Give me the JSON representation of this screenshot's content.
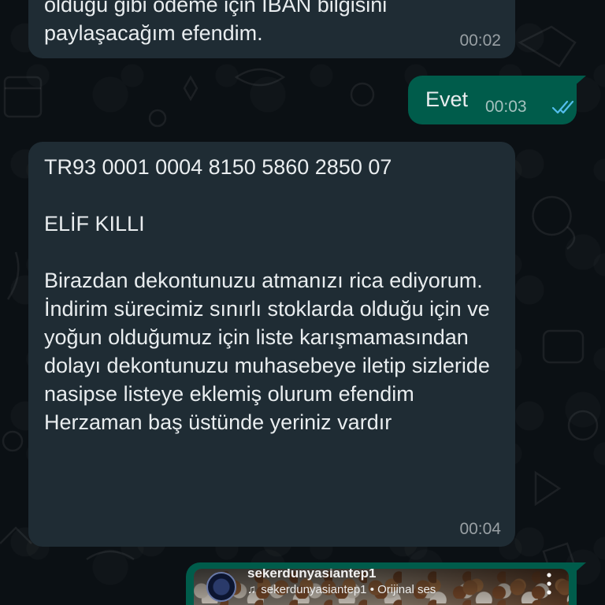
{
  "messages": {
    "m1": {
      "direction": "incoming",
      "text": "olduğu gibi ödeme için IBAN bilgisini\npaylaşacağım efendim.",
      "time": "00:02"
    },
    "m2": {
      "direction": "outgoing",
      "text": "Evet",
      "time": "00:03",
      "status": "read",
      "status_icon": "double-check-icon",
      "status_color": "#53bdeb"
    },
    "m3": {
      "direction": "incoming",
      "text": "TR93 0001 0004 8150 5860 2850 07\n\nELİF KILLI\n\nBirazdan dekontunuzu atmanızı rica ediyorum.\nİndirim sürecimiz sınırlı stoklarda olduğu için ve yoğun olduğumuz için liste karışmamasından dolayı  dekontunuzu muhasebeye iletip sizleride nasipse listeye eklemiş olurum efendim\nHerzaman baş üstünde yeriniz vardır",
      "time": "00:04"
    },
    "m4": {
      "direction": "outgoing",
      "type": "shared-reel",
      "account": "sekerdunyasiantep1",
      "audio_account": "sekerdunyasiantep1",
      "audio_label": "Orijinal ses",
      "audio_separator": "•",
      "audio_icon": "music-note-icon",
      "more_icon": "more-vertical-icon"
    }
  },
  "colors": {
    "background": "#0b1014",
    "incoming_bubble": "#1f2c34",
    "outgoing_bubble": "#005c4b",
    "text": "#e9edef",
    "read_ticks": "#53bdeb"
  }
}
